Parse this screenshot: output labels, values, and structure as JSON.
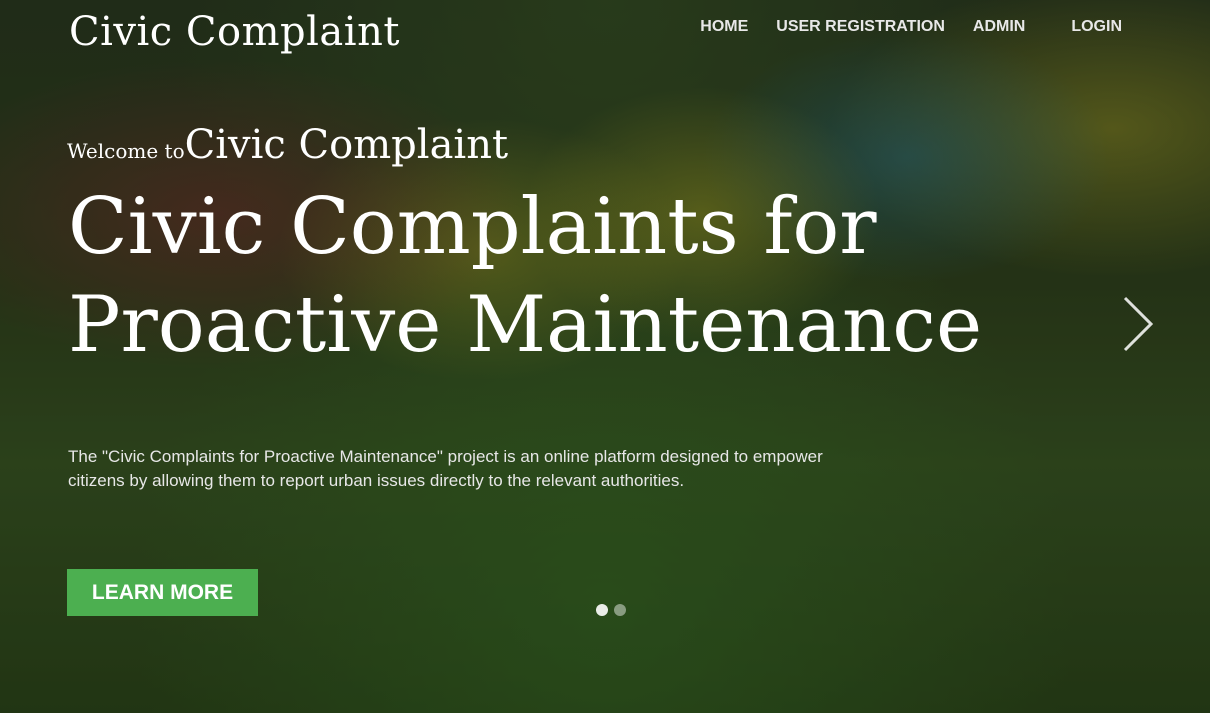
{
  "brand": "Civic Complaint",
  "nav": {
    "home": "HOME",
    "user_registration": "USER REGISTRATION",
    "admin": "ADMIN",
    "login": "LOGIN"
  },
  "hero": {
    "welcome_prefix": "Welcome to",
    "welcome_name": "Civic Complaint",
    "title_line1": "Civic Complaints for",
    "title_line2": "Proactive Maintenance",
    "description": "The \"Civic Complaints for Proactive Maintenance\" project is an online platform designed to empower citizens by allowing them to report urban issues directly to the relevant authorities.",
    "cta_label": "LEARN MORE"
  },
  "carousel": {
    "slides_count": 2,
    "active_index": 0
  },
  "colors": {
    "accent": "#4caf50",
    "text": "#ffffff"
  },
  "icons": {
    "next": "chevron-right-icon"
  }
}
